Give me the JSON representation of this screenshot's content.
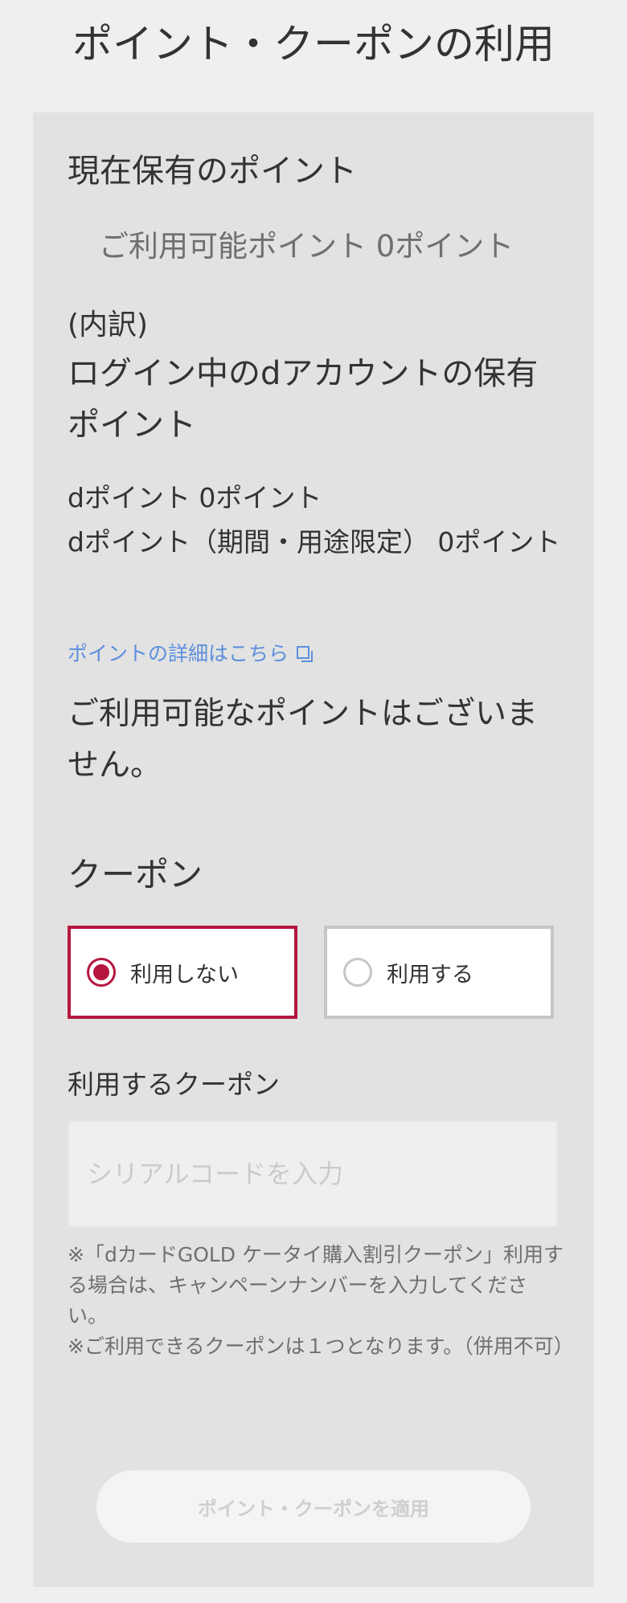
{
  "page": {
    "title": "ポイント・クーポンの利用"
  },
  "points": {
    "heading": "現在保有のポイント",
    "available": "ご利用可能ポイント 0ポイント",
    "breakdown_label": "(内訳)",
    "account_heading": "ログイン中のdアカウントの保有ポイント",
    "dpoint": "dポイント 0ポイント",
    "dpoint_limited": "dポイント（期間・用途限定） 0ポイント",
    "details_link": "ポイントの詳細はこちら",
    "details_link_icon": "external-link-icon",
    "no_points_message": "ご利用可能なポイントはございません。"
  },
  "coupon": {
    "heading": "クーポン",
    "options": [
      {
        "label": "利用しない",
        "selected": true
      },
      {
        "label": "利用する",
        "selected": false
      }
    ],
    "input_label": "利用するクーポン",
    "input_placeholder": "シリアルコードを入力",
    "input_value": "",
    "notes": [
      "※「dカードGOLD ケータイ購入割引クーポン」利用する場合は、キャンペーンナンバーを入力してください。",
      "※ご利用できるクーポンは１つとなります。（併用不可）"
    ]
  },
  "apply_button": {
    "label": "ポイント・クーポンを適用",
    "enabled": false
  },
  "colors": {
    "accent": "#b5173f",
    "link": "#5b8fdc",
    "card_background": "#e2e2e2",
    "page_background": "#efefef"
  }
}
